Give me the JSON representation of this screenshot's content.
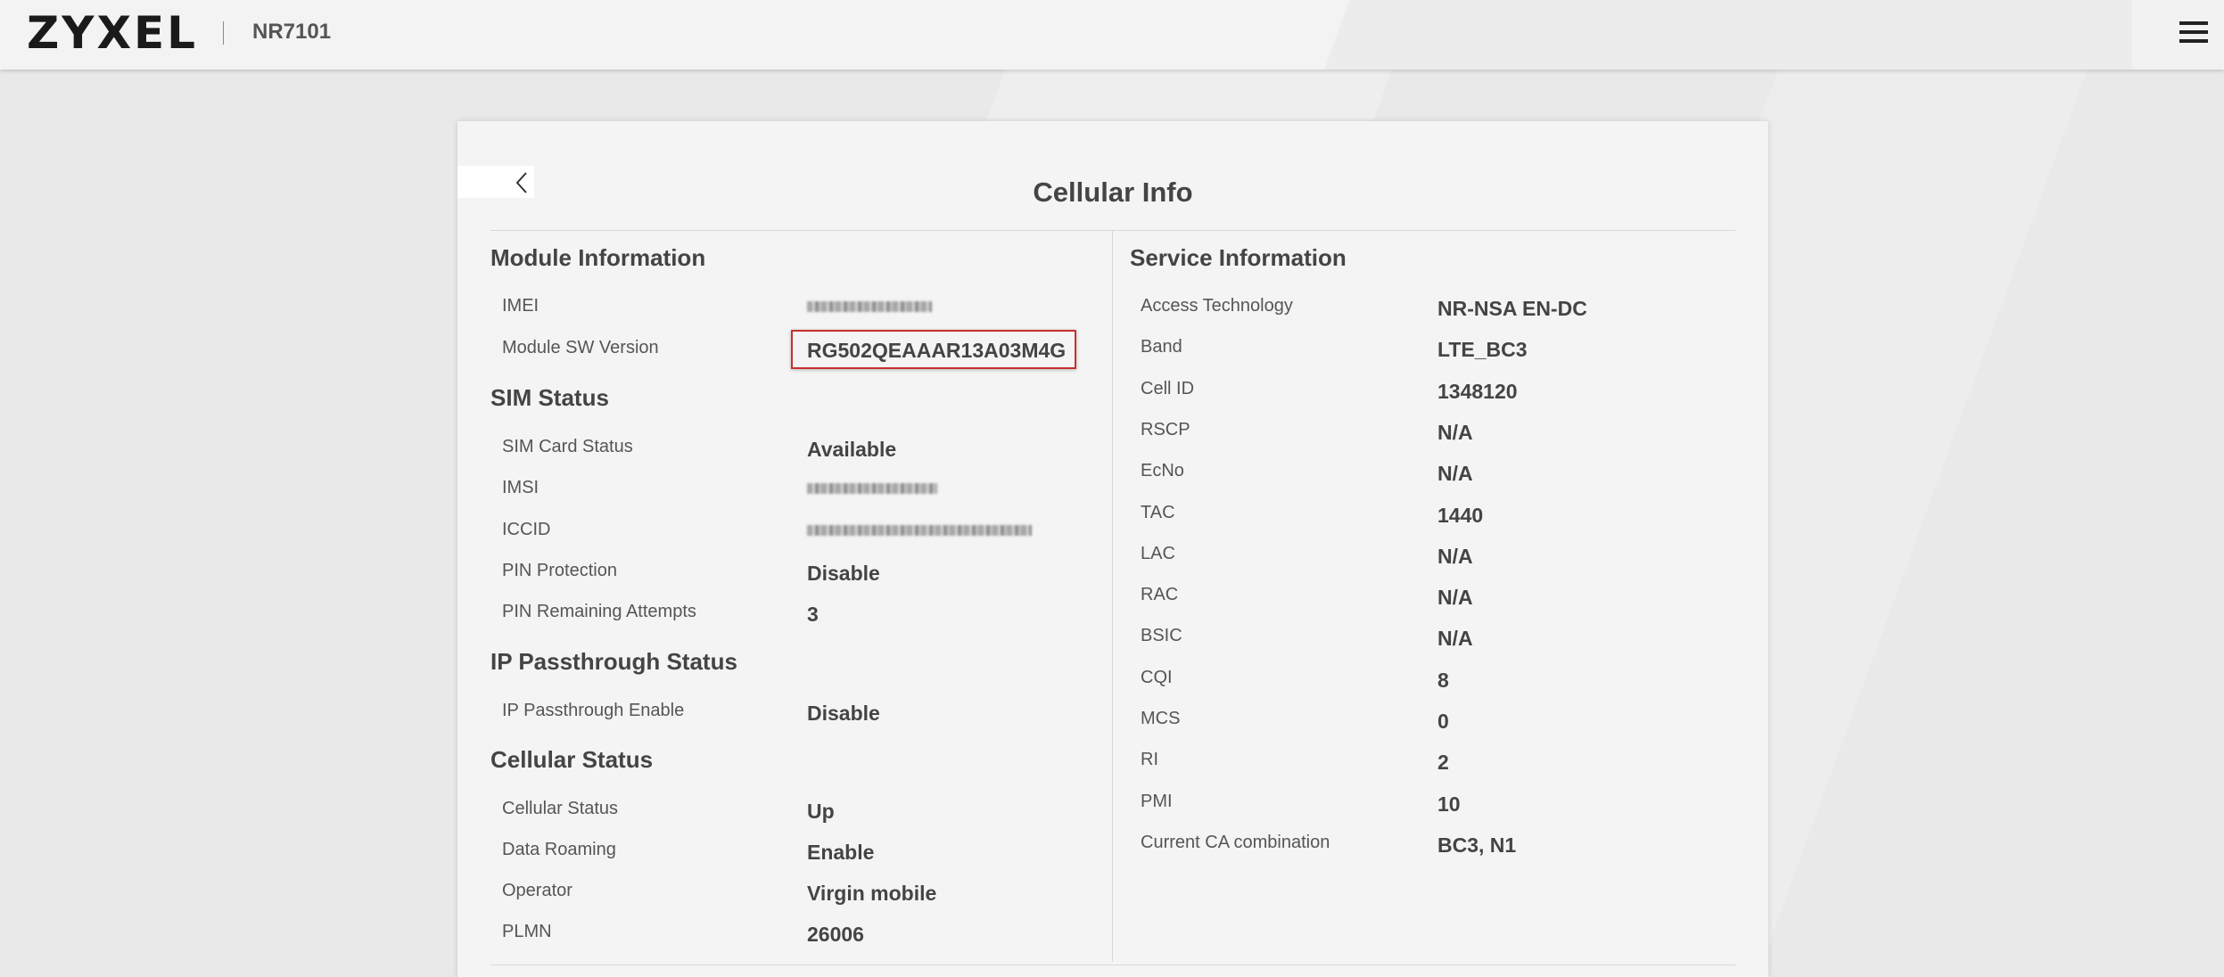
{
  "header": {
    "logo": "ZYXEL",
    "model": "NR7101"
  },
  "page": {
    "title": "Cellular Info"
  },
  "module_information": {
    "title": "Module Information",
    "imei_label": "IMEI",
    "sw_version_label": "Module SW Version",
    "sw_version_value": "RG502QEAAAR13A03M4G"
  },
  "sim_status": {
    "title": "SIM Status",
    "card_status_label": "SIM Card Status",
    "card_status_value": "Available",
    "imsi_label": "IMSI",
    "iccid_label": "ICCID",
    "pin_protection_label": "PIN Protection",
    "pin_protection_value": "Disable",
    "pin_attempts_label": "PIN Remaining Attempts",
    "pin_attempts_value": "3"
  },
  "ip_passthrough": {
    "title": "IP Passthrough Status",
    "enable_label": "IP Passthrough Enable",
    "enable_value": "Disable"
  },
  "cellular_status": {
    "title": "Cellular Status",
    "status_label": "Cellular Status",
    "status_value": "Up",
    "roaming_label": "Data Roaming",
    "roaming_value": "Enable",
    "operator_label": "Operator",
    "operator_value": "Virgin mobile",
    "plmn_label": "PLMN",
    "plmn_value": "26006"
  },
  "service_information": {
    "title": "Service Information",
    "rows": [
      {
        "label": "Access Technology",
        "value": "NR-NSA EN-DC"
      },
      {
        "label": "Band",
        "value": "LTE_BC3"
      },
      {
        "label": "Cell ID",
        "value": "1348120"
      },
      {
        "label": "RSCP",
        "value": "N/A"
      },
      {
        "label": "EcNo",
        "value": "N/A"
      },
      {
        "label": "TAC",
        "value": "1440"
      },
      {
        "label": "LAC",
        "value": "N/A"
      },
      {
        "label": "RAC",
        "value": "N/A"
      },
      {
        "label": "BSIC",
        "value": "N/A"
      },
      {
        "label": "CQI",
        "value": "8"
      },
      {
        "label": "MCS",
        "value": "0"
      },
      {
        "label": "RI",
        "value": "2"
      },
      {
        "label": "PMI",
        "value": "10"
      },
      {
        "label": "Current CA combination",
        "value": "BC3, N1"
      }
    ]
  },
  "icons": {
    "menu": "hamburger-menu-icon",
    "back": "chevron-left-icon"
  },
  "colors": {
    "highlight_border": "#c9302c",
    "card_background": "#f4f4f4",
    "page_background": "#e9e9e9"
  }
}
